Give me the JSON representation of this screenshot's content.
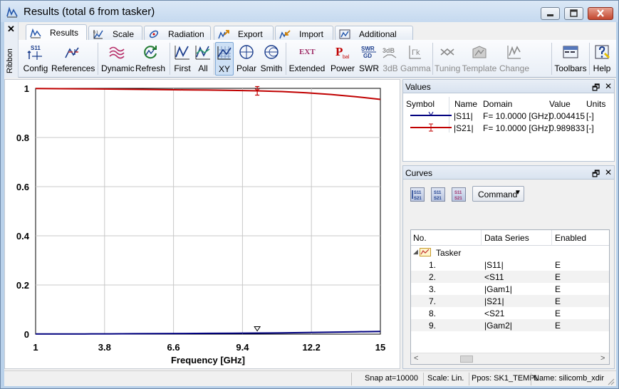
{
  "window": {
    "title": "Results (total 6 from tasker)",
    "icon": "results-graph-icon"
  },
  "ribbon": {
    "close_glyph": "✕",
    "side_label": "Ribbon",
    "tabs": [
      {
        "label": "Results",
        "icon": "results-tab-icon",
        "active": true
      },
      {
        "label": "Scale",
        "icon": "scale-tab-icon"
      },
      {
        "label": "Radiation",
        "icon": "radiation-tab-icon"
      },
      {
        "label": "Export",
        "icon": "export-tab-icon"
      },
      {
        "label": "Import",
        "icon": "import-tab-icon"
      },
      {
        "label": "Additional",
        "icon": "additional-tab-icon"
      }
    ],
    "buttons": {
      "config": "Config",
      "references": "References",
      "dynamic": "Dynamic",
      "refresh": "Refresh",
      "first": "First",
      "all": "All",
      "xy": "XY",
      "polar": "Polar",
      "smith": "Smith",
      "extended": "Extended",
      "power": "Power",
      "swr": "SWR",
      "db3": "3dB",
      "gamma": "Gamma",
      "tuning": "Tuning",
      "template": "Template",
      "change": "Change",
      "toolbars": "Toolbars",
      "help": "Help"
    },
    "icon_text": {
      "config": "S11",
      "extended": "EXT",
      "power": "P",
      "power_sub": "bal",
      "swr_top": "SWR",
      "swr_bottom": "GD",
      "db3": "3dB",
      "gamma": "Γk"
    }
  },
  "chart_data": {
    "type": "line",
    "xlabel": "Frequency [GHz]",
    "ylabel": "",
    "xlim": [
      1,
      15
    ],
    "ylim": [
      0,
      1
    ],
    "xticks": [
      "1",
      "3.8",
      "6.6",
      "9.4",
      "12.2",
      "15"
    ],
    "yticks": [
      "0",
      "0.2",
      "0.4",
      "0.6",
      "0.8",
      "1"
    ],
    "grid": true,
    "marker_x": 10,
    "series": [
      {
        "name": "|S21|",
        "color": "#c00000",
        "x": [
          1,
          2,
          3,
          4,
          5,
          6,
          7,
          8,
          9,
          10,
          11,
          12,
          13,
          14,
          15
        ],
        "y": [
          0.999,
          0.9985,
          0.998,
          0.997,
          0.996,
          0.995,
          0.994,
          0.993,
          0.9915,
          0.989833,
          0.987,
          0.982,
          0.975,
          0.966,
          0.955
        ]
      },
      {
        "name": "|S11|",
        "color": "#00007f",
        "x": [
          1,
          2,
          3,
          4,
          5,
          6,
          7,
          8,
          9,
          10,
          11,
          12,
          13,
          14,
          15
        ],
        "y": [
          0.0005,
          0.0007,
          0.001,
          0.0013,
          0.0017,
          0.0022,
          0.0027,
          0.0033,
          0.0039,
          0.004415,
          0.005,
          0.0065,
          0.008,
          0.0095,
          0.011
        ]
      }
    ]
  },
  "values_panel": {
    "title": "Values",
    "restore_glyph": "🗗",
    "close_glyph": "✕",
    "columns": [
      "Symbol",
      "Name",
      "Domain",
      "Value",
      "Units"
    ],
    "rows": [
      {
        "name": "|S11|",
        "domain": "F= 10.0000 [GHz]",
        "value": "0.004415",
        "units": "[-]",
        "color": "#00007f"
      },
      {
        "name": "|S21|",
        "domain": "F= 10.0000 [GHz]",
        "value": "0.989833",
        "units": "[-]",
        "color": "#c00000"
      }
    ]
  },
  "curves_panel": {
    "title": "Curves",
    "restore_glyph": "🗗",
    "close_glyph": "✕",
    "command_label": "Command",
    "tool_icons": {
      "first": "S11 S21",
      "second": "S11 S21",
      "third": "S11 S21"
    },
    "columns": [
      "No.",
      "Data Series",
      "Enabled"
    ],
    "group": {
      "label": "Tasker",
      "expander": "◢"
    },
    "rows": [
      {
        "no": "1.",
        "series": "|S11|",
        "enabled": "E"
      },
      {
        "no": "2.",
        "series": "<S11",
        "enabled": "E"
      },
      {
        "no": "3.",
        "series": "|Gam1|",
        "enabled": "E"
      },
      {
        "no": "7.",
        "series": "|S21|",
        "enabled": "E"
      },
      {
        "no": "8.",
        "series": "<S21",
        "enabled": "E"
      },
      {
        "no": "9.",
        "series": "|Gam2|",
        "enabled": "E"
      }
    ]
  },
  "statusbar": {
    "snap": "Snap at=10000",
    "scale": "Scale: Lin.",
    "ppos": "Ppos: SK1_TEMPL",
    "name": "Name: silicomb_xdir"
  }
}
